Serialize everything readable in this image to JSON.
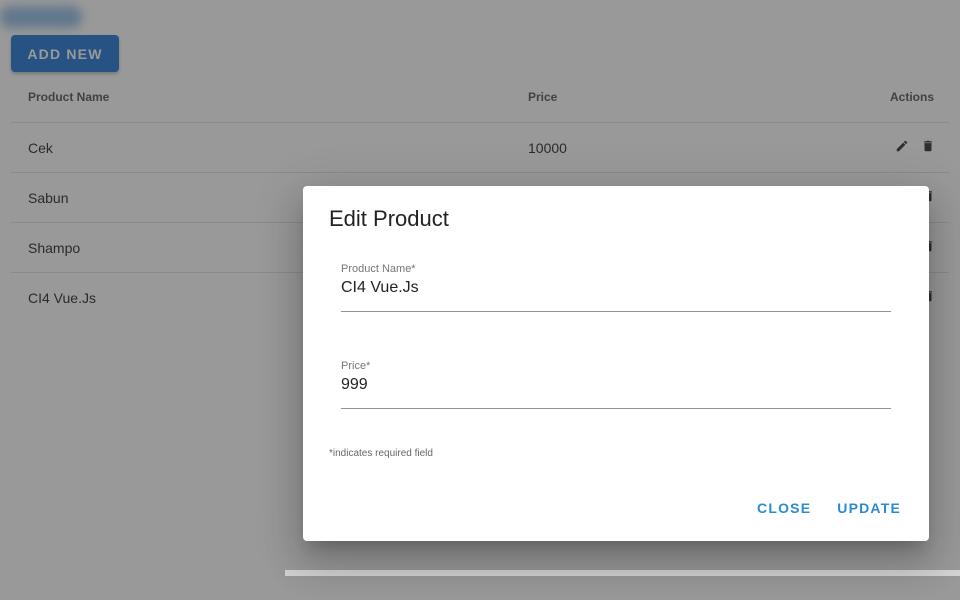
{
  "toolbar": {
    "add_new_label": "ADD NEW"
  },
  "table": {
    "headers": {
      "name": "Product Name",
      "price": "Price",
      "actions": "Actions"
    },
    "rows": [
      {
        "name": "Cek",
        "price": "10000"
      },
      {
        "name": "Sabun",
        "price": ""
      },
      {
        "name": "Shampo",
        "price": ""
      },
      {
        "name": "CI4 Vue.Js",
        "price": ""
      }
    ],
    "action_icons": [
      "pencil-icon",
      "trash-icon"
    ]
  },
  "dialog": {
    "title": "Edit Product",
    "fields": {
      "name": {
        "label": "Product Name*",
        "value": "CI4 Vue.Js"
      },
      "price": {
        "label": "Price*",
        "value": "999"
      }
    },
    "hint": "*indicates required field",
    "close_label": "CLOSE",
    "update_label": "UPDATE"
  },
  "colors": {
    "primary": "#2b7fd6",
    "dialog_action": "#2b8bd0",
    "scrim": "rgba(33,33,33,0.46)"
  }
}
